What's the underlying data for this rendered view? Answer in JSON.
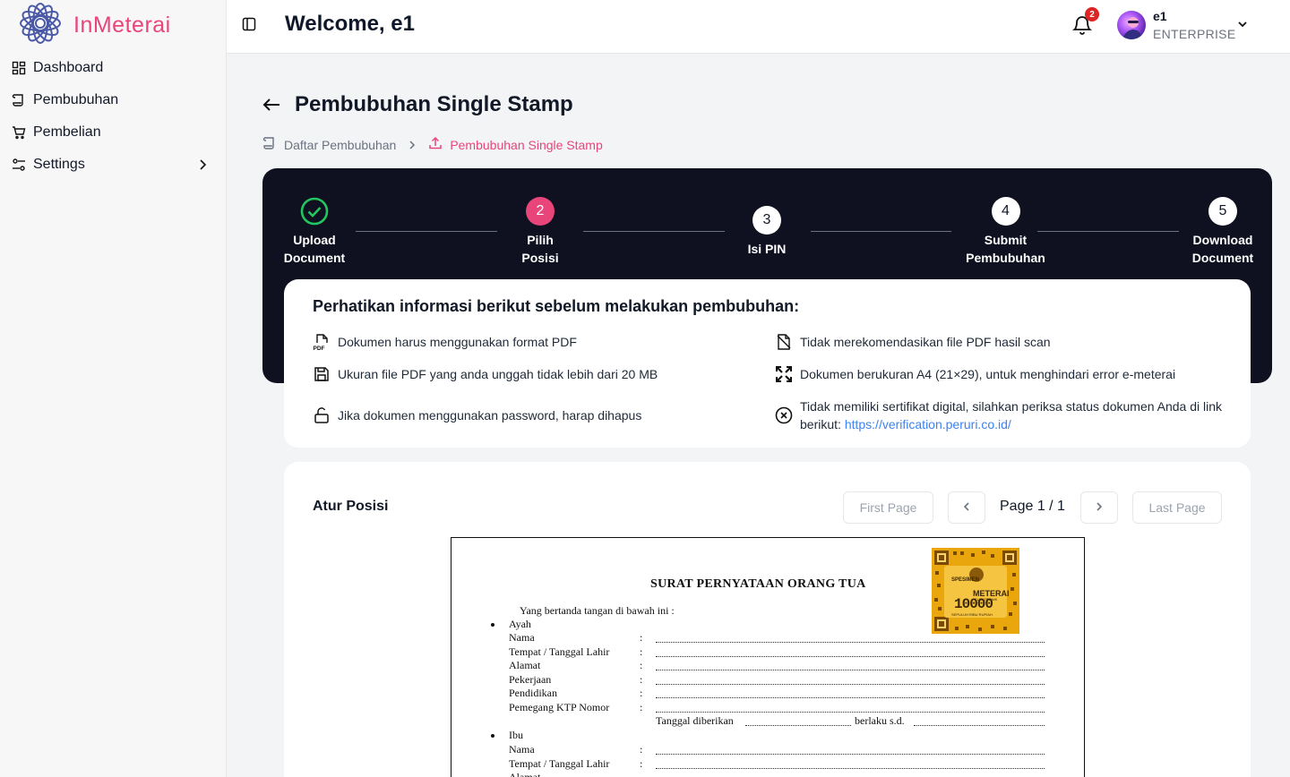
{
  "brand": {
    "name_prefix": "In",
    "name_suffix": "Meterai",
    "logo_icon": "flower-logo-icon"
  },
  "sidebar": {
    "items": [
      {
        "label": "Dashboard",
        "icon": "grid-icon"
      },
      {
        "label": "Pembubuhan",
        "icon": "scroll-icon"
      },
      {
        "label": "Pembelian",
        "icon": "cart-icon"
      },
      {
        "label": "Settings",
        "icon": "sliders-icon"
      }
    ]
  },
  "header": {
    "welcome": "Welcome, e1",
    "notification_count": "2",
    "user": {
      "name": "e1",
      "role": "ENTERPRISE"
    }
  },
  "page": {
    "title": "Pembubuhan Single Stamp",
    "breadcrumb": [
      "Daftar Pembubuhan",
      "Pembubuhan Single Stamp"
    ]
  },
  "stepper": {
    "steps": [
      {
        "number": "",
        "line1": "Upload",
        "line2": "Document",
        "state": "done"
      },
      {
        "number": "2",
        "line1": "Pilih",
        "line2": "Posisi",
        "state": "current"
      },
      {
        "number": "3",
        "line1": "Isi PIN",
        "line2": "",
        "state": "pending"
      },
      {
        "number": "4",
        "line1": "Submit",
        "line2": "Pembubuhan",
        "state": "pending"
      },
      {
        "number": "5",
        "line1": "Download",
        "line2": "Document",
        "state": "pending"
      }
    ],
    "accent": "#e8457a",
    "done_color": "#22c55e"
  },
  "info": {
    "title": "Perhatikan informasi berikut sebelum melakukan pembubuhan:",
    "items": [
      {
        "text": "Dokumen harus menggunakan format PDF",
        "icon": "pdf-file-icon"
      },
      {
        "text": "Tidak merekomendasikan file PDF hasil scan",
        "icon": "file-scan-icon"
      },
      {
        "text": "Ukuran file PDF yang anda unggah tidak lebih dari 20 MB",
        "icon": "floppy-disk-icon"
      },
      {
        "text": "Dokumen berukuran A4 (21×29), untuk menghindari error e-meterai",
        "icon": "expand-icon"
      },
      {
        "text": "Jika dokumen menggunakan password, harap dihapus",
        "icon": "unlock-icon"
      },
      {
        "text": "Tidak memiliki sertifikat digital, silahkan periksa status dokumen Anda di link berikut:",
        "icon": "x-circle-icon"
      }
    ],
    "link": "https://verification.peruri.co.id/"
  },
  "position": {
    "title": "Atur Posisi",
    "first_page": "First Page",
    "last_page": "Last Page",
    "page_label": "Page 1 / 1"
  },
  "document": {
    "title": "SURAT PERNYATAAN ORANG TUA",
    "intro": "Yang bertanda tangan di bawah ini :",
    "section1": "Ayah",
    "section2": "Ibu",
    "fields": [
      "Nama",
      "Tempat / Tanggal Lahir",
      "Alamat",
      "Pekerjaan",
      "Pendidikan",
      "Pemegang KTP Nomor"
    ],
    "ktp_given": "Tanggal diberikan",
    "valid_until": "berlaku s.d.",
    "stamp": {
      "spesimen": "SPESIMEN",
      "label": "METERAI",
      "sublabel": "ELEKTRONIK",
      "value": "10000",
      "footer": "SEPULUH RIBU RUPIAH"
    }
  }
}
